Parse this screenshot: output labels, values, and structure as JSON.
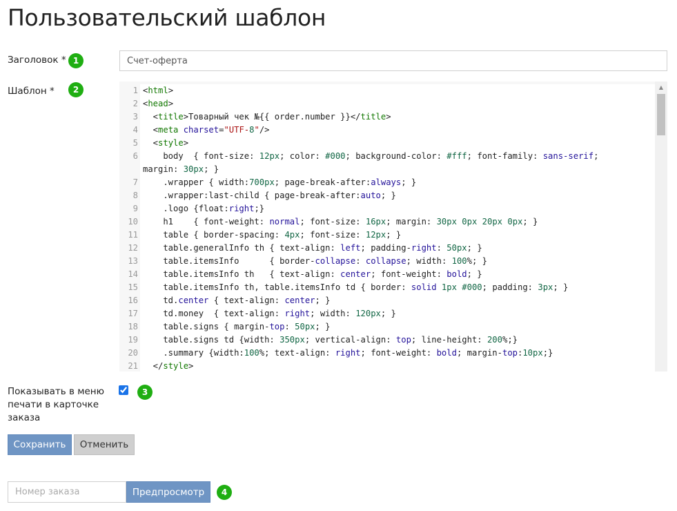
{
  "page": {
    "title": "Пользовательский шаблон"
  },
  "form": {
    "title_field": {
      "label": "Заголовок *",
      "value": "Счет-оферта",
      "step": "1"
    },
    "template_field": {
      "label": "Шаблон *",
      "step": "2"
    },
    "show_in_print_menu": {
      "label_lines": [
        "Показывать в меню",
        "печати в карточке",
        "заказа"
      ],
      "checked": true,
      "step": "3"
    },
    "save_button": "Сохранить",
    "cancel_button": "Отменить"
  },
  "preview": {
    "order_input_placeholder": "Номер заказа",
    "preview_button": "Предпросмотр",
    "step": "4"
  },
  "code_lines": [
    {
      "n": "1",
      "text": "<html>"
    },
    {
      "n": "2",
      "text": "<head>"
    },
    {
      "n": "3",
      "text": "  <title>Товарный чек №{{ order.number }}</title>"
    },
    {
      "n": "4",
      "text": "  <meta charset=\"UTF-8\"/>"
    },
    {
      "n": "5",
      "text": "  <style>"
    },
    {
      "n": "6",
      "text": "    body  { font-size: 12px; color: #000; background-color: #fff; font-family: sans-serif;"
    },
    {
      "n": "",
      "text": "margin: 30px; }"
    },
    {
      "n": "7",
      "text": "    .wrapper { width:700px; page-break-after:always; }"
    },
    {
      "n": "8",
      "text": "    .wrapper:last-child { page-break-after:auto; }"
    },
    {
      "n": "9",
      "text": "    .logo {float:right;}"
    },
    {
      "n": "10",
      "text": "    h1    { font-weight: normal; font-size: 16px; margin: 30px 0px 20px 0px; }"
    },
    {
      "n": "11",
      "text": "    table { border-spacing: 4px; font-size: 12px; }"
    },
    {
      "n": "12",
      "text": "    table.generalInfo th { text-align: left; padding-right: 50px; }"
    },
    {
      "n": "13",
      "text": "    table.itemsInfo      { border-collapse: collapse; width: 100%; }"
    },
    {
      "n": "14",
      "text": "    table.itemsInfo th   { text-align: center; font-weight: bold; }"
    },
    {
      "n": "15",
      "text": "    table.itemsInfo th, table.itemsInfo td { border: solid 1px #000; padding: 3px; }"
    },
    {
      "n": "16",
      "text": "    td.center { text-align: center; }"
    },
    {
      "n": "17",
      "text": "    td.money  { text-align: right; width: 120px; }"
    },
    {
      "n": "18",
      "text": "    table.signs { margin-top: 50px; }"
    },
    {
      "n": "19",
      "text": "    table.signs td {width: 350px; vertical-align: top; line-height: 200%;}"
    },
    {
      "n": "20",
      "text": "    .summary {width:100%; text-align: right; font-weight: bold; margin-top:10px;}"
    },
    {
      "n": "21",
      "text": "  </style>"
    }
  ],
  "colors": {
    "badge": "#1fae12",
    "primary_button": "#6f95c4",
    "secondary_button": "#cfcfcf"
  },
  "icons": {
    "scroll_up": "triangle-up-icon"
  }
}
